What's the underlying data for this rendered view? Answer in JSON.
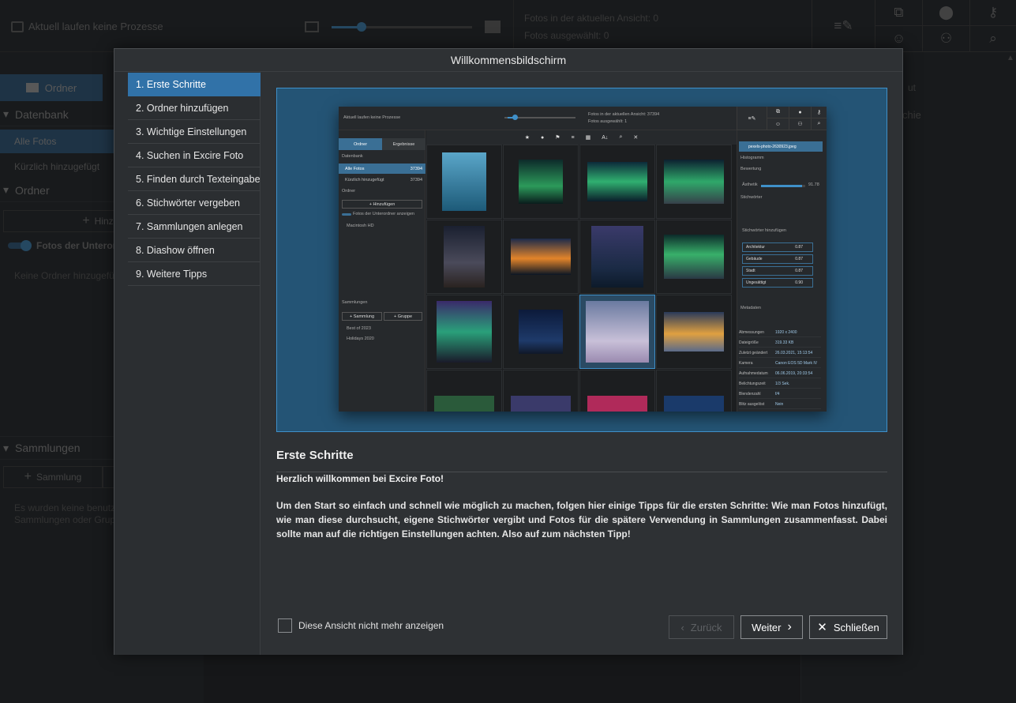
{
  "app": {
    "status_process": "Aktuell laufen keine Prozesse",
    "photos_in_view": "Fotos in der aktuellen Ansicht: 0",
    "photos_selected": "Fotos ausgewählt: 0",
    "tab_folder": "Ordner",
    "section_database": "Datenbank",
    "row_all_photos": "Alle Fotos",
    "row_recent": "Kürzlich hinzugefügt",
    "section_folder": "Ordner",
    "btn_add": "Hinzuf",
    "toggle_subfolders": "Fotos der Unteror",
    "no_folders": "Keine Ordner hinzugefü",
    "section_collections": "Sammlungen",
    "btn_collection": "Sammlung",
    "no_collections_line1": "Es wurden keine benutz",
    "no_collections_line2": "Sammlungen oder Grup",
    "right_text_a": "ut",
    "right_text_b": "chie"
  },
  "dialog": {
    "title": "Willkommensbildschirm",
    "steps": [
      {
        "label": "1. Erste Schritte",
        "active": true
      },
      {
        "label": "2. Ordner hinzufügen",
        "active": false
      },
      {
        "label": "3. Wichtige Einstellungen",
        "active": false
      },
      {
        "label": "4. Suchen in Excire Foto",
        "active": false
      },
      {
        "label": "5. Finden durch Texteingabe",
        "active": false
      },
      {
        "label": "6. Stichwörter vergeben",
        "active": false
      },
      {
        "label": "7. Sammlungen anlegen",
        "active": false
      },
      {
        "label": "8. Diashow öffnen",
        "active": false
      },
      {
        "label": "9. Weitere Tipps",
        "active": false
      }
    ],
    "content_title": "Erste Schritte",
    "content_subtitle": "Herzlich willkommen bei Excire Foto!",
    "content_body": "Um den Start so einfach und schnell wie möglich zu machen, folgen hier einige Tipps für die ersten Schritte: Wie man Fotos hinzufügt, wie man diese durchsucht, eigene Stichwörter vergibt und Fotos für die spätere Verwendung in Sammlungen zusammenfasst. Dabei sollte man auf die richtigen Einstellungen achten. Also auf zum nächsten Tipp!",
    "dont_show_label": "Diese Ansicht nicht mehr anzeigen",
    "dont_show_checked": false,
    "btn_back": "Zurück",
    "btn_next": "Weiter",
    "btn_close": "Schließen"
  },
  "preview": {
    "status_process": "Aktuell laufen keine Prozesse",
    "photos_in_view": "Fotos in der aktuellen Ansicht: 37394",
    "photos_selected": "Fotos ausgewählt: 1",
    "tab_folder": "Ordner",
    "tab_results": "Ergebnisse",
    "section_database": "Datenbank",
    "row_all_photos": "Alle Fotos",
    "row_all_count": "37394",
    "row_recent": "Kürzlich hinzugefügt",
    "row_recent_count": "37394",
    "section_folder": "Ordner",
    "btn_add": "Hinzufügen",
    "toggle_subfolders": "Fotos der Unterordner anzeigen",
    "drive": "Macintosh HD",
    "section_collections": "Sammlungen",
    "btn_collection": "Sammlung",
    "btn_group": "Gruppe",
    "collection_1": "Best of 2023",
    "collection_2": "Holidays 2020",
    "file_name": "pexels-photo-2630923.jpeg",
    "histogram": "Histogramm",
    "rating": "Bewertung",
    "aesthetic_label": "Ästhetik",
    "aesthetic_value": "91.78",
    "aesthetic_fraction": 0.92,
    "keywords": "Stichwörter",
    "keyword_placeholder": "Stichwörter hinzufügen",
    "keyword_list": [
      {
        "label": "Architektur",
        "score": "0.87"
      },
      {
        "label": "Gebäude",
        "score": "0.87"
      },
      {
        "label": "Stadt",
        "score": "0.87"
      },
      {
        "label": "Ungesättigt",
        "score": "0.90"
      }
    ],
    "metadata": "Metadaten",
    "meta_rows": [
      {
        "k": "Abmessungen",
        "v": "1920 x 2400"
      },
      {
        "k": "Dateigröße",
        "v": "319.33 KB"
      },
      {
        "k": "Zuletzt geändert",
        "v": "26.03.2021, 15:13:54"
      },
      {
        "k": "Kamera",
        "v": "Canon EOS 5D Mark IV"
      },
      {
        "k": "Aufnahmedatum",
        "v": "06.06.2019, 20:33:54"
      },
      {
        "k": "Belichtungszeit",
        "v": "1/3 Sek."
      },
      {
        "k": "Blendenzahl",
        "v": "f/4"
      },
      {
        "k": "Blitz ausgelöst",
        "v": "Nein"
      }
    ]
  }
}
